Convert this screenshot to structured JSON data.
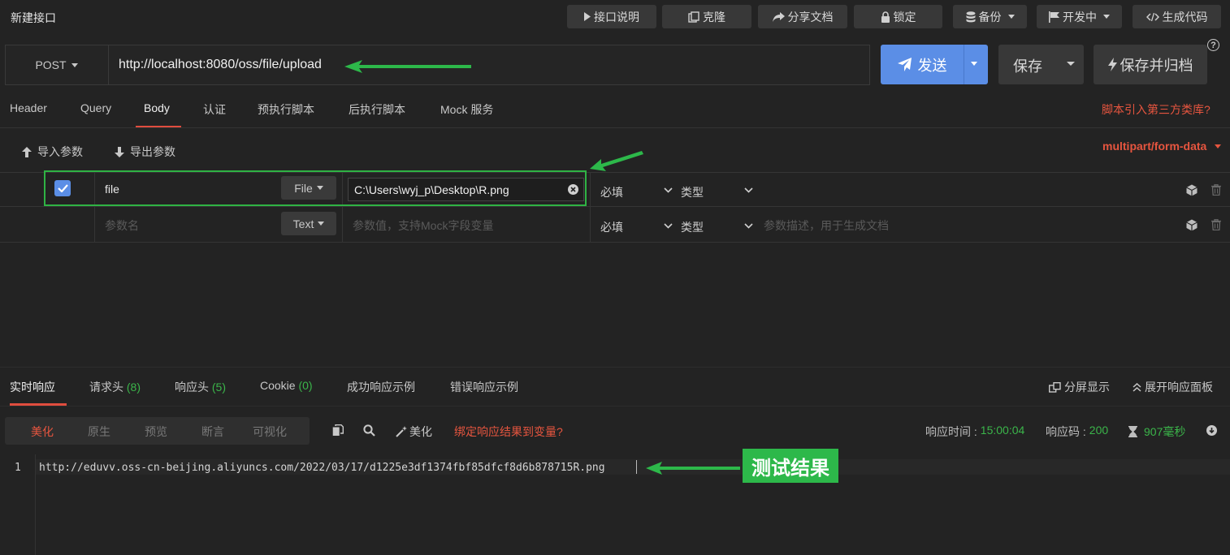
{
  "header": {
    "title": "新建接口",
    "buttons": {
      "api_doc": "接口说明",
      "clone": "克隆",
      "share": "分享文档",
      "lock": "锁定",
      "backup": "备份",
      "status": "开发中",
      "codegen": "生成代码"
    },
    "help": "?"
  },
  "request": {
    "method": "POST",
    "url": "http://localhost:8080/oss/file/upload",
    "send": "发送",
    "save": "保存",
    "save_archive": "保存并归档"
  },
  "tabs": {
    "items": [
      "Header",
      "Query",
      "Body",
      "认证",
      "预执行脚本",
      "后执行脚本",
      "Mock 服务"
    ],
    "active": "Body",
    "script_link": "脚本引入第三方类库?"
  },
  "body_toolbar": {
    "import": "导入参数",
    "export": "导出参数",
    "content_type": "multipart/form-data"
  },
  "params": {
    "rows": [
      {
        "checked": true,
        "name": "file",
        "type": "File",
        "value": "C:\\Users\\wyj_p\\Desktop\\R.png",
        "required": "必填",
        "datatype": "类型"
      }
    ],
    "new_row": {
      "name_placeholder": "参数名",
      "type": "Text",
      "value_placeholder": "参数值，支持Mock字段变量",
      "required": "必填",
      "datatype": "类型",
      "desc_placeholder": "参数描述，用于生成文档"
    }
  },
  "response": {
    "tabs": {
      "realtime": "实时响应",
      "req_headers": "请求头",
      "req_headers_count": "(8)",
      "resp_headers": "响应头",
      "resp_headers_count": "(5)",
      "cookie": "Cookie",
      "cookie_count": "(0)",
      "success_example": "成功响应示例",
      "error_example": "错误响应示例"
    },
    "split_view": "分屏显示",
    "expand": "展开响应面板",
    "formats": [
      "美化",
      "原生",
      "预览",
      "断言",
      "可视化"
    ],
    "active_format": "美化",
    "beautify": "美化",
    "bind_var": "绑定响应结果到变量?",
    "time_label": "响应时间 :",
    "time_value": "15:00:04",
    "code_label": "响应码 :",
    "code_value": "200",
    "duration": "907毫秒",
    "line_number": "1",
    "body": "http://eduvv.oss-cn-beijing.aliyuncs.com/2022/03/17/d1225e3df1374fbf85dfcf8d6b878715R.png"
  },
  "annotation": {
    "label": "测试结果",
    "color": "#2db84a"
  },
  "colors": {
    "accent_blue": "#5b8ee6",
    "accent_red": "#e6553f",
    "success_green": "#3bb54a"
  }
}
